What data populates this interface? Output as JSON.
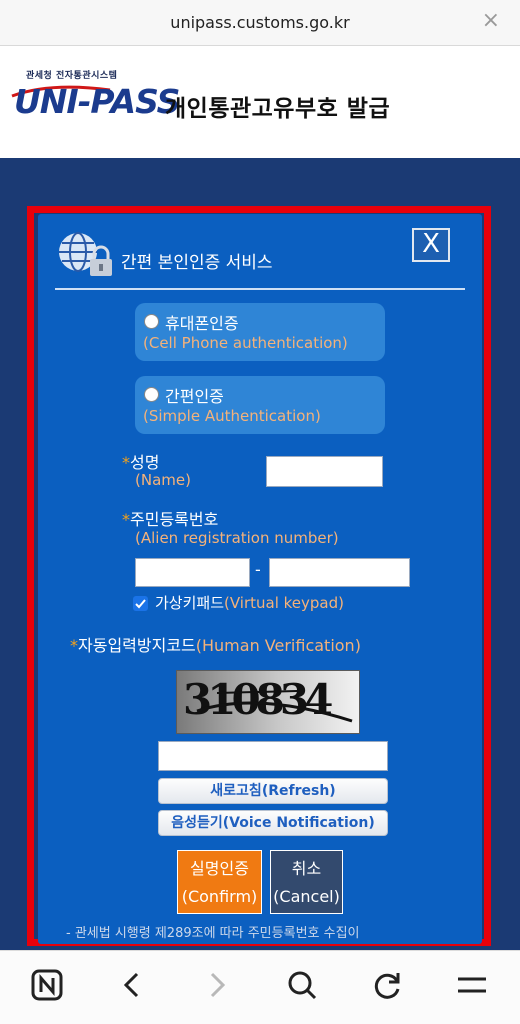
{
  "browser": {
    "url": "unipass.customs.go.kr",
    "close_glyph": "×"
  },
  "header": {
    "logo_small_text": "관세청 전자통관시스템",
    "logo_text": "UNI-PASS",
    "title": "개인통관고유부호 발급"
  },
  "dialog": {
    "title": "간편 본인인증 서비스",
    "close_glyph": "X",
    "options": [
      {
        "label": "휴대폰인증",
        "label_en": "(Cell Phone authentication)"
      },
      {
        "label": "간편인증",
        "label_en": "(Simple Authentication)"
      }
    ],
    "name_label": "성명",
    "name_label_en": "(Name)",
    "name_value": "",
    "regno_label": "주민등록번호",
    "regno_label_en": "(Alien registration number)",
    "regno_part1": "",
    "regno_part2": "",
    "regno_separator": "-",
    "keypad_label": "가상키패드",
    "keypad_label_en": "(Virtual keypad)",
    "keypad_checked": true,
    "captcha_label": "자동입력방지코드",
    "captcha_label_en": "(Human Verification)",
    "captcha_text": "310834",
    "captcha_value": "",
    "refresh_label": "새로고침(Refresh)",
    "voice_label": "음성듣기(Voice Notification)",
    "confirm_label": "실명인증",
    "confirm_label_en": "(Confirm)",
    "cancel_label": "취소",
    "cancel_label_en": "(Cancel)",
    "note": "- 관세법 시행령 제289조에 따라 주민등록번호 수집이",
    "required_star": "*"
  },
  "toolbar": {
    "icons": [
      "naver-home-icon",
      "back-icon",
      "forward-icon",
      "search-icon",
      "refresh-icon",
      "menu-icon"
    ]
  },
  "colors": {
    "page_bg": "#1b3a74",
    "dialog_bg": "#0b5fc0",
    "highlight_frame": "#e8000b",
    "accent_orange": "#f07a12",
    "english_label": "#f4b27a"
  }
}
